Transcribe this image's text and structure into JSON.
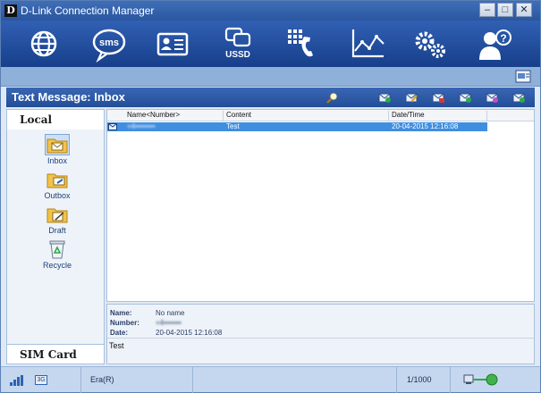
{
  "window": {
    "title": "D-Link Connection Manager",
    "logo_letter": "D"
  },
  "window_controls": {
    "minimize": "–",
    "maximize": "□",
    "close": "✕"
  },
  "toolbar": {
    "buttons": [
      {
        "icon": "globe-icon",
        "label": ""
      },
      {
        "icon": "sms-icon",
        "label": "sms"
      },
      {
        "icon": "contacts-icon",
        "label": ""
      },
      {
        "icon": "ussd-icon",
        "label": "USSD"
      },
      {
        "icon": "dialer-icon",
        "label": ""
      },
      {
        "icon": "statistics-icon",
        "label": ""
      },
      {
        "icon": "settings-icon",
        "label": ""
      },
      {
        "icon": "help-icon",
        "label": ""
      }
    ]
  },
  "section": {
    "title": "Text Message: Inbox",
    "action_icons": [
      "search-icon",
      "new-message-icon",
      "edit-icon",
      "delete-icon",
      "reply-icon",
      "forward-icon",
      "save-icon"
    ]
  },
  "sidebar": {
    "local_header": "Local",
    "folders": [
      {
        "label": "Inbox",
        "icon": "inbox-folder-icon",
        "selected": true
      },
      {
        "label": "Outbox",
        "icon": "outbox-folder-icon",
        "selected": false
      },
      {
        "label": "Draft",
        "icon": "draft-folder-icon",
        "selected": false
      },
      {
        "label": "Recycle",
        "icon": "recycle-bin-icon",
        "selected": false
      }
    ],
    "sim_header": "SIM Card"
  },
  "message_list": {
    "columns": [
      "Name<Number>",
      "Content",
      "Date/Time"
    ],
    "rows": [
      {
        "name": "+4••••••••",
        "content": "Test",
        "datetime": "20-04-2015 12:16:08"
      }
    ]
  },
  "detail": {
    "name_label": "Name:",
    "name_value": "No name",
    "number_label": "Number:",
    "number_value": "+4•••••••",
    "date_label": "Date:",
    "date_value": "20-04-2015 12:16:08",
    "body": "Test"
  },
  "status": {
    "network_type": "3G",
    "operator": "Era(R)",
    "message_count": "1/1000"
  },
  "colors": {
    "toolbar_top": "#3160b4",
    "toolbar_bottom": "#173f8a",
    "selection": "#3f8ee0"
  }
}
